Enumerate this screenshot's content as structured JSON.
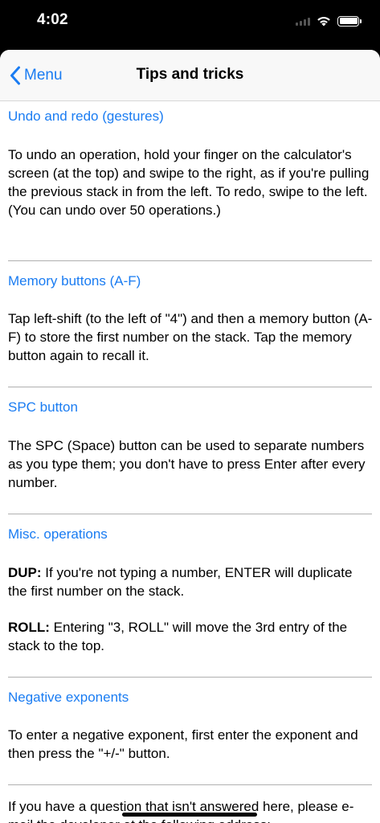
{
  "status": {
    "time": "4:02"
  },
  "nav": {
    "back_label": "Menu",
    "title": "Tips and tricks"
  },
  "sections": [
    {
      "title": "Undo and redo (gestures)",
      "paragraphs": [
        "To undo an operation, hold your finger on the calculator's screen (at the top) and swipe to the right, as if you're pulling the previous stack in from the left. To redo, swipe to the left. (You can undo over 50 operations.)"
      ]
    },
    {
      "title": "Memory buttons (A-F)",
      "paragraphs": [
        "Tap left-shift (to the left of \"4\") and then a memory button (A-F) to store the first number on the stack. Tap the memory button again to recall it."
      ]
    },
    {
      "title": "SPC button",
      "paragraphs": [
        "The SPC (Space) button can be used to separate numbers as you type them; you don't have to press Enter after every number."
      ]
    },
    {
      "title": "Misc. operations",
      "items": [
        {
          "term": "DUP:",
          "text": " If you're not typing a number, ENTER will duplicate the first number on the stack."
        },
        {
          "term": "ROLL:",
          "text": " Entering \"3, ROLL\" will move the 3rd entry of the stack to the top."
        }
      ]
    },
    {
      "title": "Negative exponents",
      "paragraphs": [
        "To enter a negative exponent, first enter the exponent and then press the \"+/-\" button."
      ]
    }
  ],
  "footer": {
    "text": "If you have a question that isn't answered here, please e-mail the developer at the following address:"
  },
  "colors": {
    "accent": "#1a7cf2",
    "divider": "#b0b0b0"
  },
  "icons": {
    "back": "chevron-left-icon",
    "wifi": "wifi-icon",
    "battery": "battery-icon",
    "cellular": "cellular-signal-icon"
  }
}
